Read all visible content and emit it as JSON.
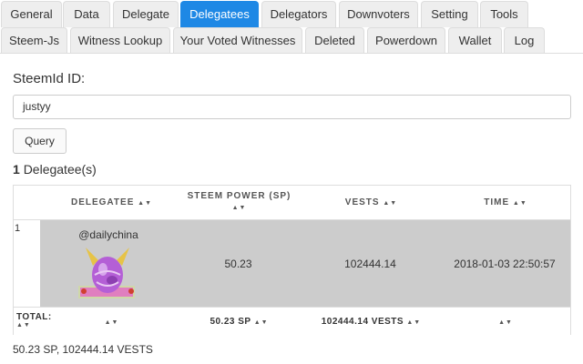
{
  "tabs": {
    "row1": [
      {
        "label": "General",
        "active": false
      },
      {
        "label": "Data",
        "active": false
      },
      {
        "label": "Delegate",
        "active": false
      },
      {
        "label": "Delegatees",
        "active": true
      },
      {
        "label": "Delegators",
        "active": false
      },
      {
        "label": "Downvoters",
        "active": false
      },
      {
        "label": "Setting",
        "active": false
      },
      {
        "label": "Tools",
        "active": false
      }
    ],
    "row2": [
      {
        "label": "Steem-Js",
        "active": false
      },
      {
        "label": "Witness Lookup",
        "active": false
      },
      {
        "label": "Your Voted Witnesses",
        "active": false
      },
      {
        "label": "Deleted",
        "active": false
      },
      {
        "label": "Powerdown",
        "active": false
      },
      {
        "label": "Wallet",
        "active": false
      },
      {
        "label": "Log",
        "active": false
      }
    ]
  },
  "form": {
    "id_label": "SteemId ID:",
    "id_value": "justyy",
    "query_label": "Query"
  },
  "result": {
    "count": "1",
    "count_label": "Delegatee(s)"
  },
  "table": {
    "headers": {
      "delegatee": "DELEGATEE",
      "steem_power_line1": "STEEM POWER (SP)",
      "vests": "VESTS",
      "time": "TIME"
    },
    "sort_glyph": "▲▼",
    "rows": [
      {
        "index": "1",
        "delegatee": "@dailychina",
        "steem_power": "50.23",
        "vests": "102444.14",
        "time": "2018-01-03 22:50:57"
      }
    ],
    "footer": {
      "total_label": "TOTAL:",
      "sp_total": "50.23 SP",
      "vests_total": "102444.14 VESTS"
    }
  },
  "summary": "50.23 SP, 102444.14 VESTS",
  "colors": {
    "active_tab": "#1e88e5",
    "row_highlight": "#cccccc"
  }
}
